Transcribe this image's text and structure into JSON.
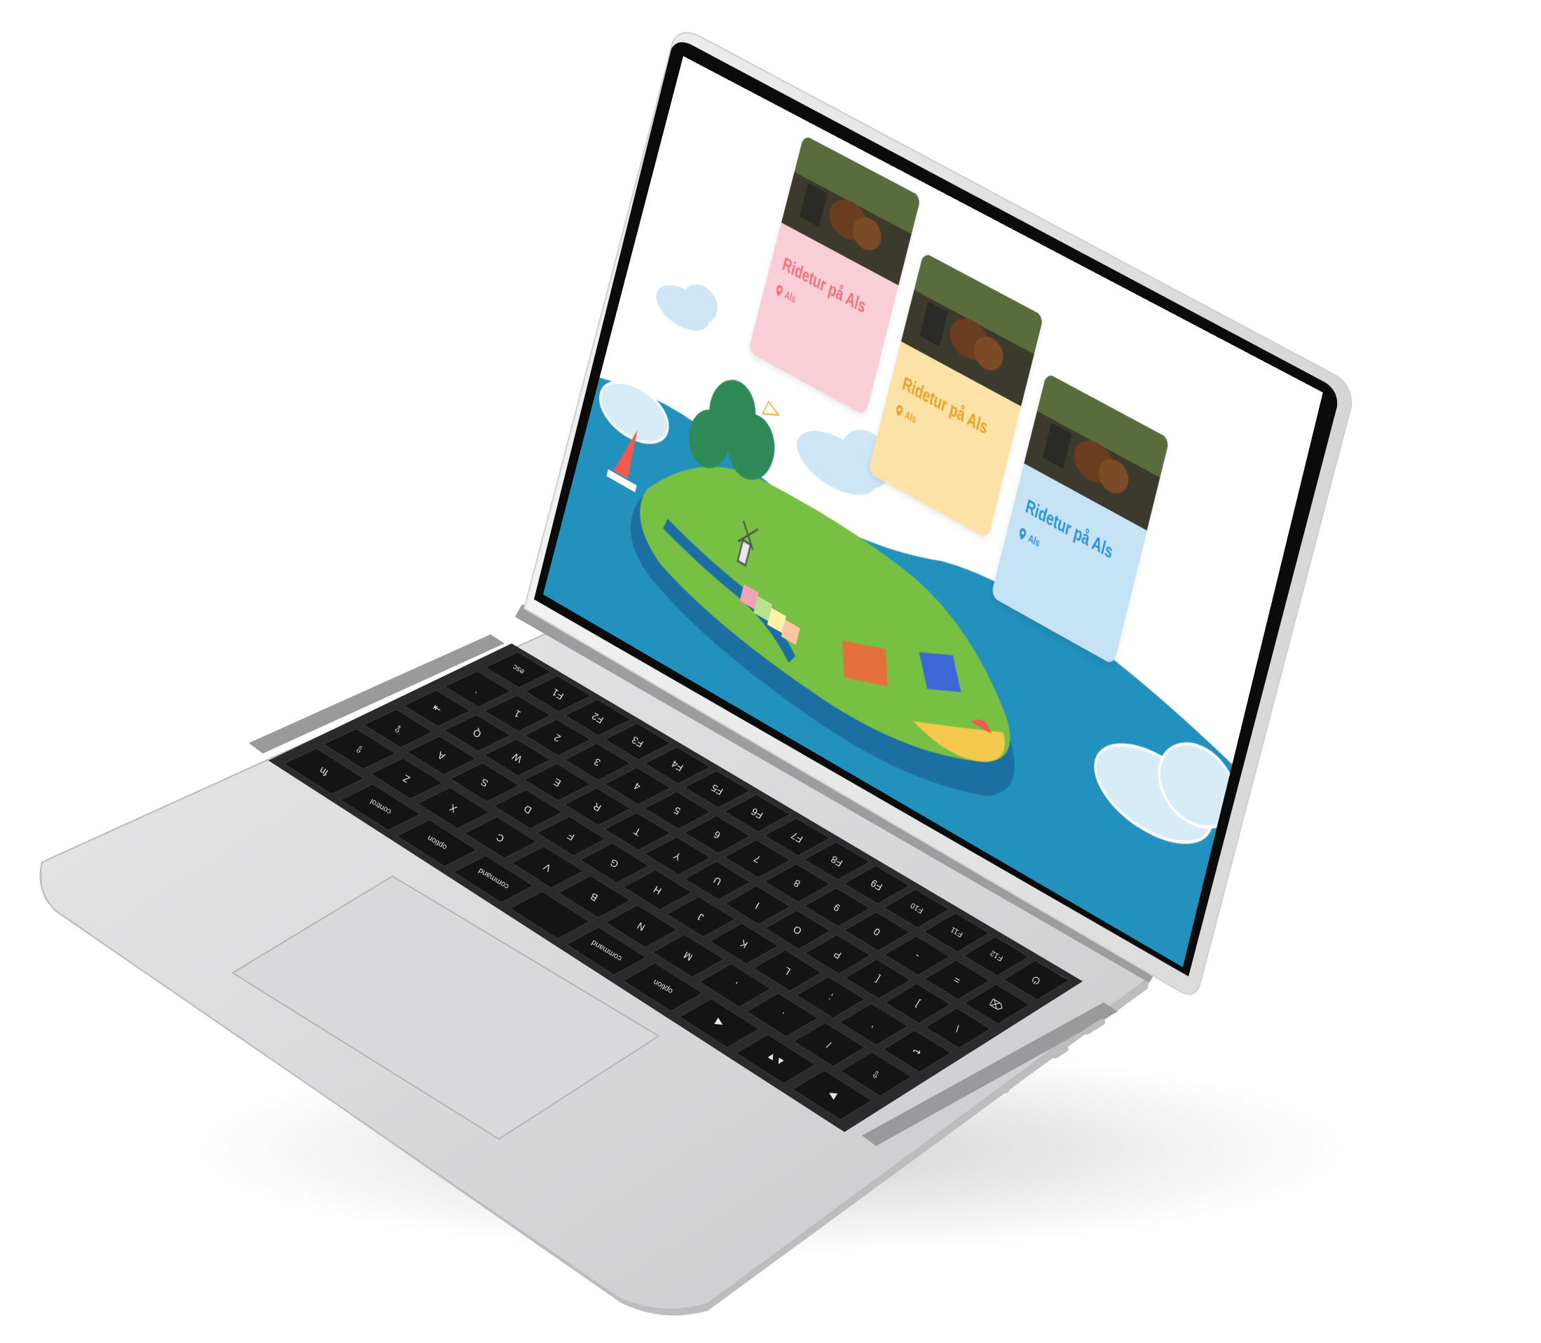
{
  "website": {
    "cards": [
      {
        "kicker": "",
        "title": "Ridetur på Als",
        "location": "Als",
        "theme": "pink",
        "accent": "#f0707c"
      },
      {
        "kicker": "",
        "title": "Ridetur på Als",
        "location": "Als",
        "theme": "yellow",
        "accent": "#e8a221"
      },
      {
        "kicker": "",
        "title": "Ridetur på Als",
        "location": "Als",
        "theme": "blue",
        "accent": "#2a93d4"
      }
    ],
    "colors": {
      "sea": "#2291bd",
      "sea_dark": "#1c6fa3",
      "grass": "#77c043",
      "grass_dark": "#4a9b3b",
      "cloud": "#cfe6f6"
    }
  },
  "keyboard": {
    "rows": [
      [
        "esc",
        "F1",
        "F2",
        "F3",
        "F4",
        "F5",
        "F6",
        "F7",
        "F8",
        "F9",
        "F10",
        "F11",
        "F12",
        "⏻"
      ],
      [
        "`",
        "1",
        "2",
        "3",
        "4",
        "5",
        "6",
        "7",
        "8",
        "9",
        "0",
        "-",
        "=",
        "⌫"
      ],
      [
        "⇥",
        "Q",
        "W",
        "E",
        "R",
        "T",
        "Y",
        "U",
        "I",
        "O",
        "P",
        "[",
        "]",
        "\\"
      ],
      [
        "⇪",
        "A",
        "S",
        "D",
        "F",
        "G",
        "H",
        "J",
        "K",
        "L",
        ";",
        "'",
        "↩"
      ],
      [
        "⇧",
        "Z",
        "X",
        "C",
        "V",
        "B",
        "N",
        "M",
        ",",
        ".",
        "/",
        "⇧"
      ],
      [
        "fn",
        "control",
        "option",
        "command",
        "",
        "command",
        "option",
        "◀",
        "▲▼",
        "▶"
      ]
    ]
  }
}
